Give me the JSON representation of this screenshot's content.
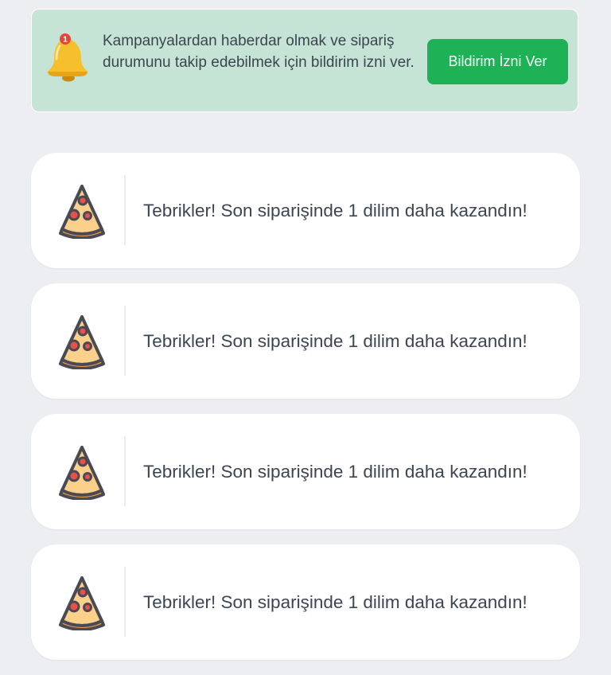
{
  "permission_banner": {
    "message": "Kampanyalardan haberdar olmak ve sipariş durumunu takip edebilmek için bildirim izni ver.",
    "bell_badge_count": "1",
    "button_label": "Bildirim İzni Ver",
    "bell_icon": "bell-icon",
    "colors": {
      "background": "#c6e4d5",
      "button": "#1fb155",
      "bell": "#f6c02c",
      "badge": "#e8453a"
    }
  },
  "notifications": [
    {
      "icon": "pizza-slice-icon",
      "text": "Tebrikler! Son siparişinde 1 dilim daha kazandın!"
    },
    {
      "icon": "pizza-slice-icon",
      "text": "Tebrikler! Son siparişinde 1 dilim daha kazandın!"
    },
    {
      "icon": "pizza-slice-icon",
      "text": "Tebrikler! Son siparişinde 1 dilim daha kazandın!"
    },
    {
      "icon": "pizza-slice-icon",
      "text": "Tebrikler! Son siparişinde 1 dilim daha kazandın!"
    }
  ]
}
